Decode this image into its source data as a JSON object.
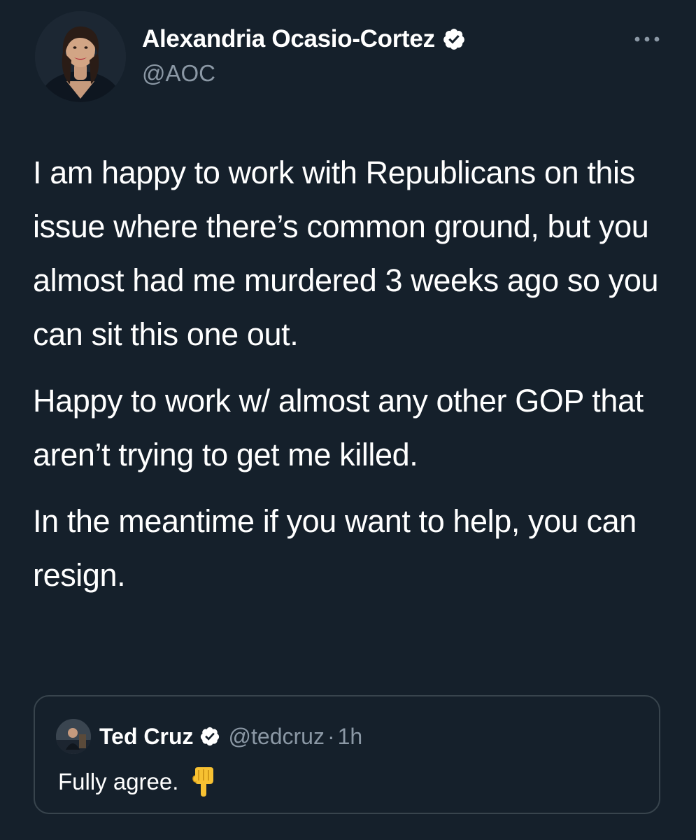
{
  "tweet": {
    "author": {
      "name": "Alexandria Ocasio-Cortez",
      "handle": "@AOC",
      "verified_icon": "verified-badge-icon",
      "avatar_icon": "profile-photo"
    },
    "more_icon": "more-options-icon",
    "paragraphs": [
      "I am happy to work with Republicans on this issue where there’s common ground, but you almost had me murdered 3 weeks ago so you can sit this one out.",
      "Happy to work w/ almost any other GOP that aren’t trying to get me killed.",
      "In the meantime if you want to help, you can resign."
    ]
  },
  "quoted_tweet": {
    "author": {
      "name": "Ted Cruz",
      "handle": "@tedcruz",
      "verified_icon": "verified-badge-icon"
    },
    "separator": "·",
    "time": "1h",
    "text": "Fully agree.",
    "emoji_icon": "backhand-index-pointing-down-icon"
  },
  "colors": {
    "background": "#15202b",
    "text_primary": "#ffffff",
    "text_secondary": "#8b98a5",
    "border": "#38444d",
    "emoji": "#f7c132"
  }
}
